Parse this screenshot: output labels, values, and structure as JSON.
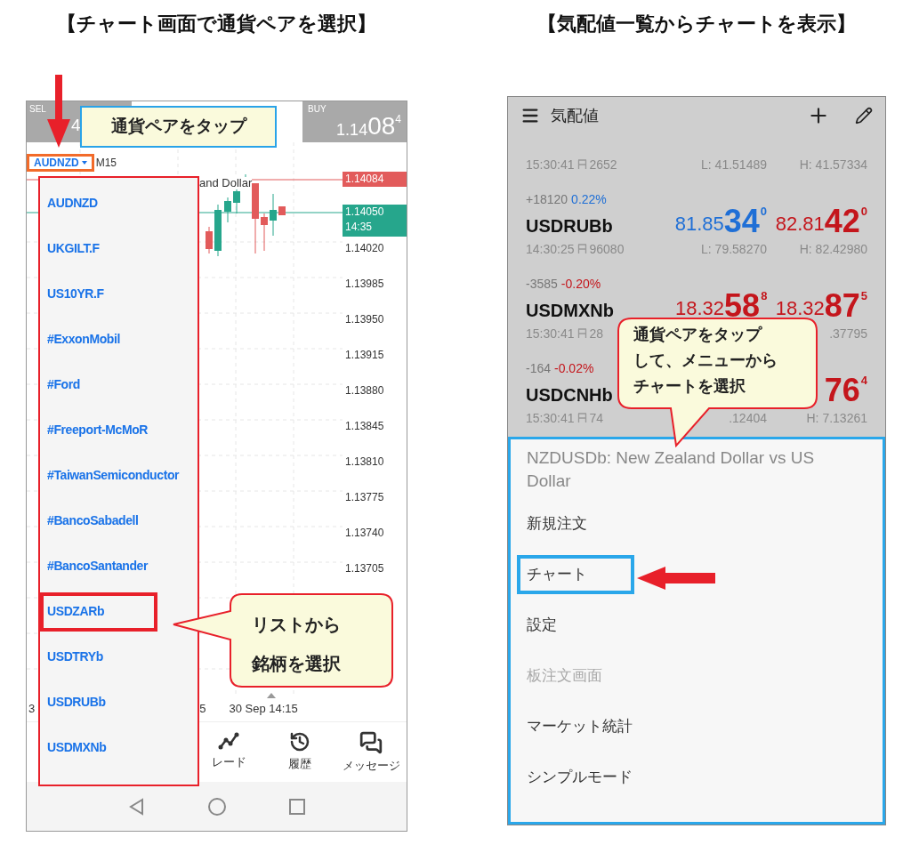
{
  "titles": [
    "【チャート画面で通貨ペアを選択】",
    "【気配値一覧からチャートを表示】"
  ],
  "chart_screen": {
    "sell": {
      "label": "SEL",
      "price": "4"
    },
    "buy": {
      "label": "BUY",
      "price_main": "1.14",
      "price_big": "08",
      "price_sup": "4"
    },
    "symbol": "AUDNZD",
    "timeframe": "M15",
    "description": "and Dollar",
    "price_tags": [
      {
        "price": "1.14084",
        "color": "#e25b5b"
      },
      {
        "price": "1.14050",
        "time": "14:35",
        "color": "#26a68c"
      }
    ],
    "price_axis": [
      "1.14020",
      "1.13985",
      "1.13950",
      "1.13915",
      "1.13880",
      "1.13845",
      "1.13810",
      "1.13775",
      "1.13740",
      "1.13705"
    ],
    "time_axis": [
      "3",
      "5",
      "30 Sep 14:15"
    ],
    "symbol_list": [
      {
        "name": "AUDNZD",
        "selected": false
      },
      {
        "name": "UKGILT.F",
        "selected": false
      },
      {
        "name": "US10YR.F",
        "selected": false
      },
      {
        "name": "#ExxonMobil",
        "selected": false
      },
      {
        "name": "#Ford",
        "selected": false
      },
      {
        "name": "#Freeport-McMoR",
        "selected": false
      },
      {
        "name": "#TaiwanSemiconductor",
        "selected": false
      },
      {
        "name": "#BancoSabadell",
        "selected": false
      },
      {
        "name": "#BancoSantander",
        "selected": false
      },
      {
        "name": "USDZARb",
        "selected": true
      },
      {
        "name": "USDTRYb",
        "selected": false
      },
      {
        "name": "USDRUBb",
        "selected": false
      },
      {
        "name": "USDMXNb",
        "selected": false
      }
    ],
    "bottom_nav": [
      {
        "kind": "trade",
        "label": "レード"
      },
      {
        "kind": "history",
        "label": "履歴"
      },
      {
        "kind": "messages",
        "label": "メッセージ"
      }
    ]
  },
  "quotes_screen": {
    "title": "気配値",
    "rows": [
      {
        "time": "15:30:41",
        "spread": "2652",
        "low": "L: 41.51489",
        "high": "H: 41.57334"
      },
      {
        "change": "+18120",
        "change_pct": "0.22%",
        "color": "#1f6fd6",
        "symbol": "USDRUBb",
        "bid": {
          "main": "81.85",
          "big": "34",
          "sup": "0",
          "color": "#1f6fd6"
        },
        "ask": {
          "main": "82.81",
          "big": "42",
          "sup": "0",
          "color": "#c4161c"
        },
        "time": "14:30:25",
        "spread": "96080",
        "low": "L: 79.58270",
        "high": "H: 82.42980"
      },
      {
        "change": "-3585",
        "change_pct": "-0.20%",
        "color": "#c4161c",
        "symbol": "USDMXNb",
        "bid": {
          "main": "18.32",
          "big": "58",
          "sup": "8",
          "color": "#c4161c"
        },
        "ask": {
          "main": "18.32",
          "big": "87",
          "sup": "5",
          "color": "#c4161c"
        },
        "time": "15:30:41",
        "spread": "28",
        "high": ".37795"
      },
      {
        "change": "-164",
        "change_pct": "-0.02%",
        "color": "#c4161c",
        "symbol": "USDCNHb",
        "ask": {
          "big": "76",
          "sup": "4",
          "color": "#c4161c"
        },
        "time": "15:30:41",
        "spread": "74",
        "low": ".12404",
        "high": "H: 7.13261"
      }
    ],
    "menu": {
      "title": "NZDUSDb: New Zealand Dollar vs US Dollar",
      "items": [
        {
          "label": "新規注文",
          "selected": false,
          "disabled": false
        },
        {
          "label": "チャート",
          "selected": true,
          "disabled": false
        },
        {
          "label": "設定",
          "selected": false,
          "disabled": false
        },
        {
          "label": "板注文画面",
          "selected": false,
          "disabled": true
        },
        {
          "label": "マーケット統計",
          "selected": false,
          "disabled": false
        },
        {
          "label": "シンプルモード",
          "selected": false,
          "disabled": false
        }
      ]
    }
  },
  "callouts": [
    {
      "lines": [
        "通貨ペアをタップ"
      ]
    },
    {
      "lines": [
        "リストから",
        "銘柄を選択"
      ]
    },
    {
      "lines": [
        "通貨ペアをタップ",
        "して、メニューから",
        "チャートを選択"
      ]
    }
  ]
}
